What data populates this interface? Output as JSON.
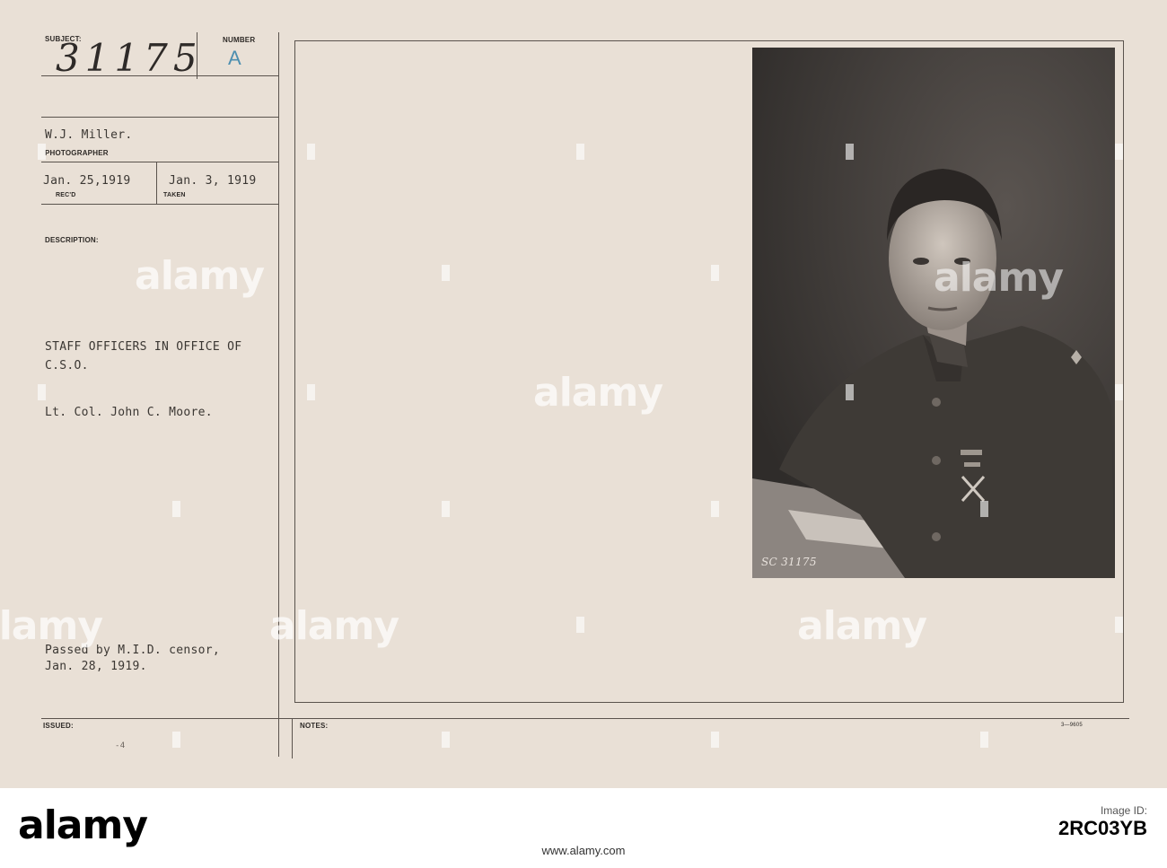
{
  "card": {
    "subject_label": "SUBJECT:",
    "subject_value": "31175",
    "number_label": "NUMBER",
    "number_value": "A",
    "photographer_name": "W.J. Miller.",
    "photographer_label": "PHOTOGRAPHER",
    "received_date": "Jan. 25,1919",
    "received_label": "REC'D",
    "taken_date": "Jan. 3, 1919",
    "taken_label": "TAKEN",
    "description_label": "DESCRIPTION:",
    "description_line1": "STAFF OFFICERS IN OFFICE OF",
    "description_line2": "C.S.O.",
    "description_line3": "Lt. Col. John C. Moore.",
    "censor_line1": "Passed by M.I.D. censor,",
    "censor_line2": "Jan. 28, 1919.",
    "issued_label": "ISSUED:",
    "issued_mark": "-4",
    "notes_label": "NOTES:",
    "form_code": "3—9605",
    "photo_number": "SC 31175"
  },
  "watermark": {
    "text": "alamy"
  },
  "footer": {
    "logo": "alamy",
    "image_id_label": "Image ID:",
    "image_id": "2RC03YB",
    "url": "www.alamy.com"
  },
  "colors": {
    "card_background": "#e9e0d6",
    "ink": "#3b3733",
    "photo_background": "#413d3a"
  }
}
